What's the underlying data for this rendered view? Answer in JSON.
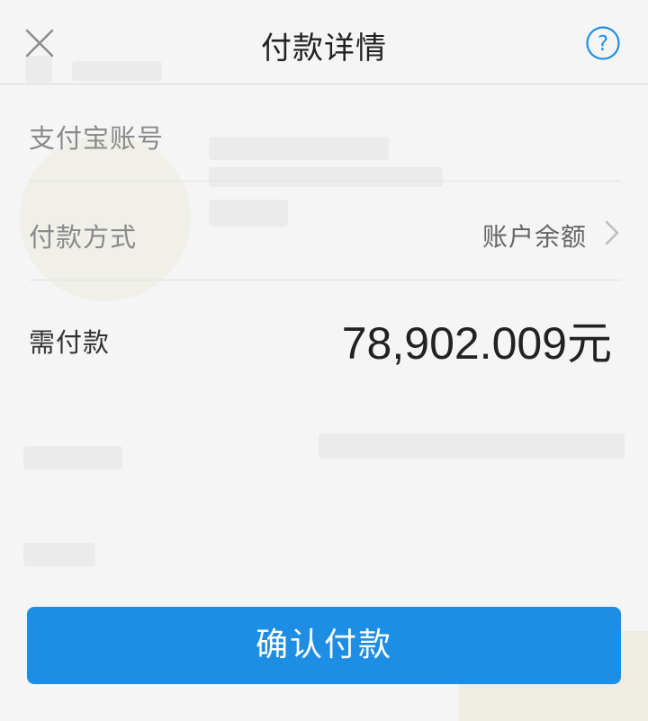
{
  "header": {
    "title": "付款详情",
    "close_icon": "close-icon",
    "help_icon": "help-circle-icon"
  },
  "rows": {
    "account": {
      "label": "支付宝账号"
    },
    "method": {
      "label": "付款方式",
      "value": "账户余额",
      "icon": "chevron-right-icon"
    },
    "amount": {
      "label": "需付款",
      "value": "78,902.009元"
    }
  },
  "confirm": {
    "label": "确认付款"
  },
  "colors": {
    "accent": "#1e8ee4",
    "background": "#f5f5f5",
    "text_primary": "#222222",
    "text_secondary": "#8a8a8a",
    "divider": "#e2e2e2"
  }
}
